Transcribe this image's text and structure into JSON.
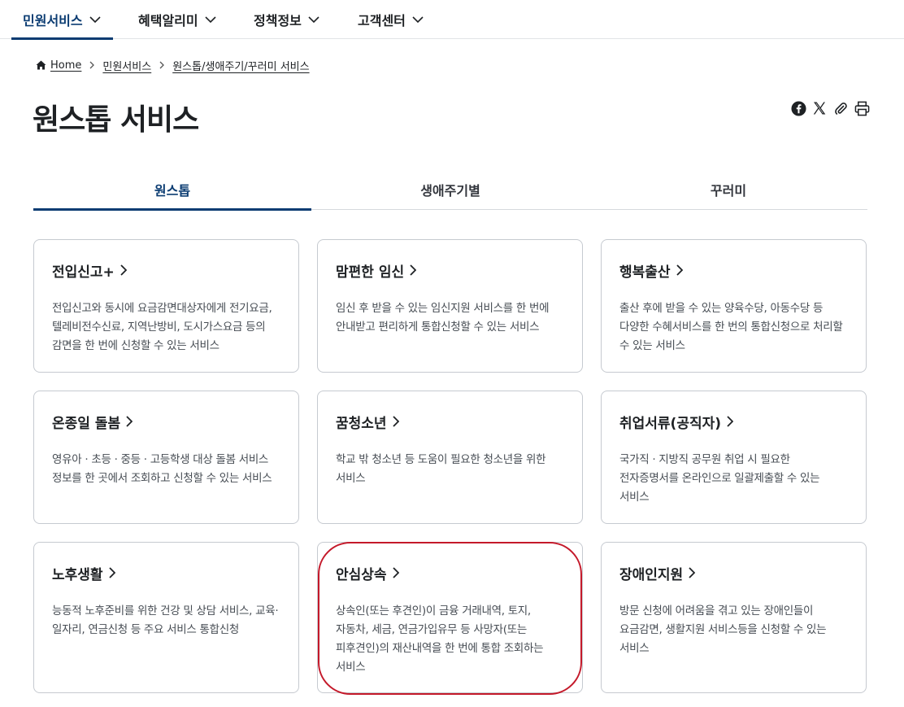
{
  "nav": {
    "items": [
      {
        "label": "민원서비스"
      },
      {
        "label": "혜택알리미"
      },
      {
        "label": "정책정보"
      },
      {
        "label": "고객센터"
      }
    ]
  },
  "breadcrumb": {
    "home": "Home",
    "level1": "민원서비스",
    "level2": "원스톱/생애주기/꾸러미 서비스"
  },
  "page": {
    "title": "원스톱 서비스"
  },
  "share": {
    "icons": [
      "facebook-icon",
      "x-icon",
      "link-icon",
      "print-icon"
    ]
  },
  "tabs": [
    {
      "label": "원스톱"
    },
    {
      "label": "생애주기별"
    },
    {
      "label": "꾸러미"
    }
  ],
  "cards": [
    {
      "title": "전입신고+",
      "desc": "전입신고와 동시에 요금감면대상자에게 전기요금, 텔레비전수신료, 지역난방비, 도시가스요금 등의 감면을 한 번에 신청할 수 있는 서비스"
    },
    {
      "title": "맘편한 임신",
      "desc": "임신 후 받을 수 있는 임신지원 서비스를 한 번에 안내받고 편리하게 통합신청할 수 있는 서비스"
    },
    {
      "title": "행복출산",
      "desc": "출산 후에 받을 수 있는 양육수당, 아동수당 등 다양한 수혜서비스를 한 번의 통합신청으로 처리할 수 있는 서비스"
    },
    {
      "title": "온종일 돌봄",
      "desc": "영유아 · 초등 · 중등 · 고등학생 대상 돌봄 서비스 정보를 한 곳에서 조회하고 신청할 수 있는 서비스"
    },
    {
      "title": "꿈청소년",
      "desc": "학교 밖 청소년 등 도움이 필요한 청소년을 위한 서비스"
    },
    {
      "title": "취업서류(공직자)",
      "desc": "국가직 · 지방직 공무원 취업 시 필요한 전자증명서를 온라인으로 일괄제출할 수 있는 서비스"
    },
    {
      "title": "노후생활",
      "desc": "능동적 노후준비를 위한 건강 및 상담 서비스, 교육·일자리, 연금신청 등 주요 서비스 통합신청"
    },
    {
      "title": "안심상속",
      "desc": "상속인(또는 후견인)이 금융 거래내역, 토지, 자동차, 세금, 연금가입유무 등 사망자(또는 피후견인)의 재산내역을 한 번에 통합 조회하는 서비스"
    },
    {
      "title": "장애인지원",
      "desc": "방문 신청에 어려움을 겪고 있는 장애인들이 요금감면, 생활지원 서비스등을 신청할 수 있는 서비스"
    }
  ],
  "colors": {
    "accent": "#0b3c72",
    "highlight_ring": "#c4192a",
    "card_border": "#c6cad0"
  }
}
